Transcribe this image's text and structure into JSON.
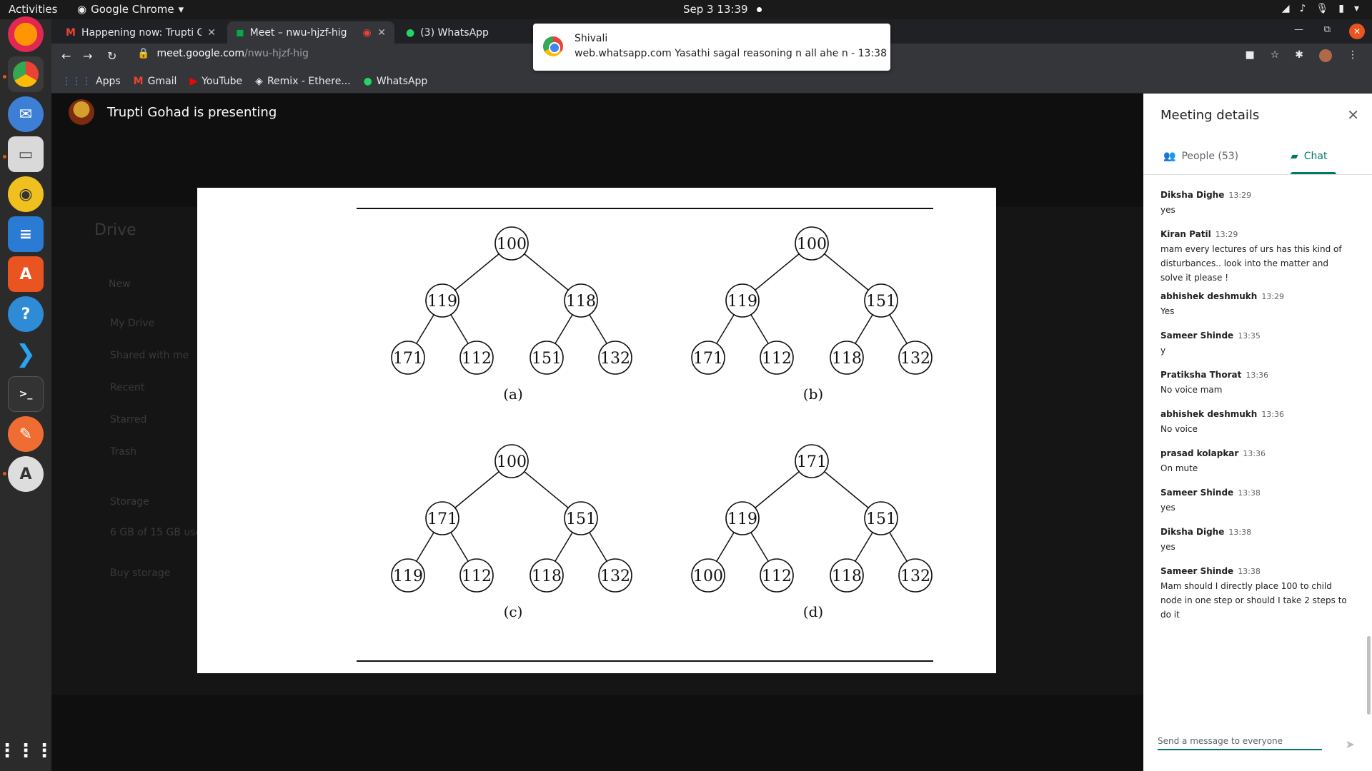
{
  "topbar": {
    "activities": "Activities",
    "app": "Google Chrome",
    "clock": "Sep 3  13:39"
  },
  "tabs": [
    {
      "label": "Happening now: Trupti G",
      "icon": "gmail-icon"
    },
    {
      "label": "Meet – nwu-hjzf-hig",
      "icon": "meet-icon"
    },
    {
      "label": "(3) WhatsApp",
      "icon": "whatsapp-icon"
    }
  ],
  "toolbar": {
    "url_host": "meet.google.com",
    "url_path": "/nwu-hjzf-hig"
  },
  "bookmarks": [
    "Apps",
    "Gmail",
    "YouTube",
    "Remix - Ethere...",
    "WhatsApp"
  ],
  "notification": {
    "title": "Shivali",
    "body": "web.whatsapp.com  Yasathi sagal reasoning n all ahe n - 13:38"
  },
  "presenter": {
    "text": "Trupti Gohad is presenting"
  },
  "drive_background": {
    "title": "Drive",
    "new": "New",
    "items": [
      "My Drive",
      "Shared with me",
      "Recent",
      "Starred",
      "Trash",
      "Storage",
      "6 GB of 15 GB used",
      "Buy storage"
    ]
  },
  "slide": {
    "trees": [
      {
        "label": "(a)",
        "nodes": [
          "100",
          "119",
          "118",
          "171",
          "112",
          "151",
          "132"
        ]
      },
      {
        "label": "(b)",
        "nodes": [
          "100",
          "119",
          "151",
          "171",
          "112",
          "118",
          "132"
        ]
      },
      {
        "label": "(c)",
        "nodes": [
          "100",
          "171",
          "151",
          "119",
          "112",
          "118",
          "132"
        ]
      },
      {
        "label": "(d)",
        "nodes": [
          "171",
          "119",
          "151",
          "100",
          "112",
          "118",
          "132"
        ]
      }
    ]
  },
  "panel": {
    "title": "Meeting details",
    "people_tab": "People (53)",
    "chat_tab": "Chat",
    "input_placeholder": "Send a message to everyone",
    "messages": [
      {
        "who": "Diksha Dighe",
        "time": "13:29",
        "text": "yes"
      },
      {
        "who": "Kiran Patil",
        "time": "13:29",
        "text": "mam every lectures of urs has this kind of disturbances.. look into the matter and solve it please !"
      },
      {
        "who": "abhishek deshmukh",
        "time": "13:29",
        "text": "Yes"
      },
      {
        "who": "Sameer Shinde",
        "time": "13:35",
        "text": "y"
      },
      {
        "who": "Pratiksha Thorat",
        "time": "13:36",
        "text": "No voice mam"
      },
      {
        "who": "abhishek deshmukh",
        "time": "13:36",
        "text": "No voice"
      },
      {
        "who": "prasad kolapkar",
        "time": "13:36",
        "text": "On mute"
      },
      {
        "who": "Sameer Shinde",
        "time": "13:38",
        "text": "yes"
      },
      {
        "who": "Diksha Dighe",
        "time": "13:38",
        "text": "yes"
      },
      {
        "who": "Sameer Shinde",
        "time": "13:38",
        "text": "Mam should I directly place 100 to child node in one step or should I take 2 steps to do it"
      }
    ]
  },
  "colors": {
    "meet_accent": "#00796b",
    "ubuntu_orange": "#e95420"
  }
}
